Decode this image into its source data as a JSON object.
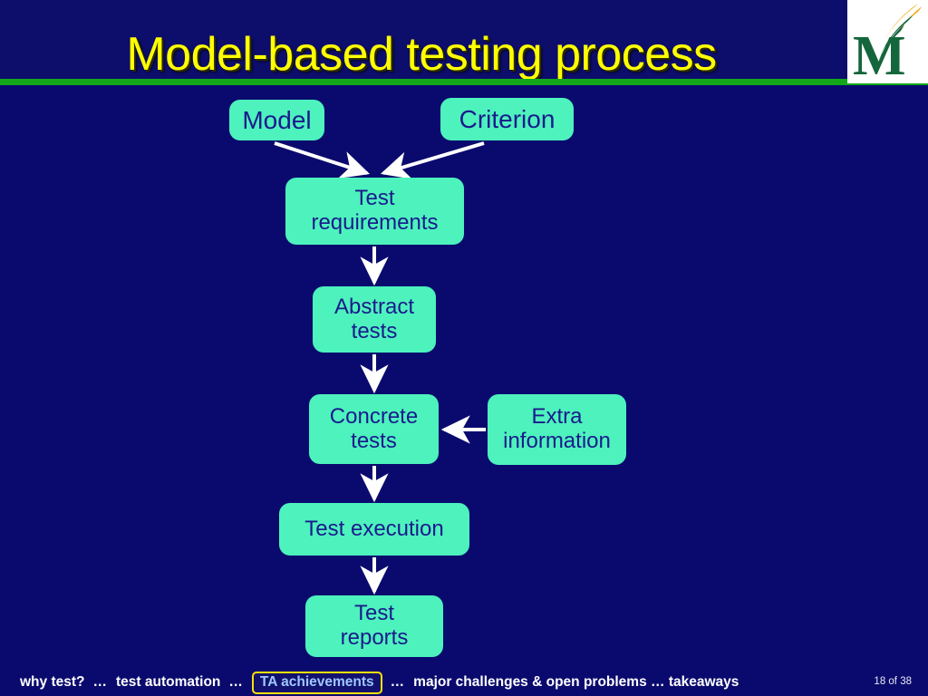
{
  "slide": {
    "title": "Model-based testing process",
    "accent_title_color": "#ffff00",
    "background_color": "#0a0a6e",
    "rule_color": "#12a81a",
    "node_fill_color": "#4df2bd",
    "node_text_color": "#1a1a8c",
    "arrow_color": "#ffffff"
  },
  "logo": {
    "name": "gmu-m-logo",
    "letter": "M",
    "letter_color": "#14663c",
    "swoosh_gold": "#f0b323",
    "swoosh_green": "#14663c",
    "plate_color": "#ffffff"
  },
  "diagram": {
    "type": "flowchart",
    "nodes": [
      {
        "id": "model",
        "label": "Model",
        "lines": [
          "Model"
        ]
      },
      {
        "id": "criterion",
        "label": "Criterion",
        "lines": [
          "Criterion"
        ]
      },
      {
        "id": "testreq",
        "label": "Test requirements",
        "lines": [
          "Test",
          "requirements"
        ]
      },
      {
        "id": "abstract",
        "label": "Abstract tests",
        "lines": [
          "Abstract",
          "tests"
        ]
      },
      {
        "id": "concrete",
        "label": "Concrete tests",
        "lines": [
          "Concrete",
          "tests"
        ]
      },
      {
        "id": "extra",
        "label": "Extra information",
        "lines": [
          "Extra",
          "information"
        ]
      },
      {
        "id": "testexec",
        "label": "Test execution",
        "lines": [
          "Test execution"
        ]
      },
      {
        "id": "testreports",
        "label": "Test reports",
        "lines": [
          "Test",
          "reports"
        ]
      }
    ],
    "edges": [
      {
        "from": "model",
        "to": "testreq"
      },
      {
        "from": "criterion",
        "to": "testreq"
      },
      {
        "from": "testreq",
        "to": "abstract"
      },
      {
        "from": "abstract",
        "to": "concrete"
      },
      {
        "from": "extra",
        "to": "concrete"
      },
      {
        "from": "concrete",
        "to": "testexec"
      },
      {
        "from": "testexec",
        "to": "testreports"
      }
    ]
  },
  "footer": {
    "segments": [
      {
        "text": "why test?",
        "current": false
      },
      {
        "text": "…",
        "separator": true
      },
      {
        "text": "test automation",
        "current": false
      },
      {
        "text": "…",
        "separator": true
      },
      {
        "text": "TA achievements",
        "current": true
      },
      {
        "text": "…",
        "separator": true
      },
      {
        "text": "major challenges & open problems … takeaways",
        "current": false
      }
    ],
    "seg_1": "why test?",
    "sep_1": "…",
    "seg_2": "test automation",
    "sep_2": "…",
    "seg_current": "TA achievements",
    "sep_3": "…",
    "seg_3": "major challenges & open problems … takeaways",
    "page_number": "18 of 38",
    "highlight_border_color": "#ffe000",
    "highlight_text_color": "#9fc8ff"
  }
}
